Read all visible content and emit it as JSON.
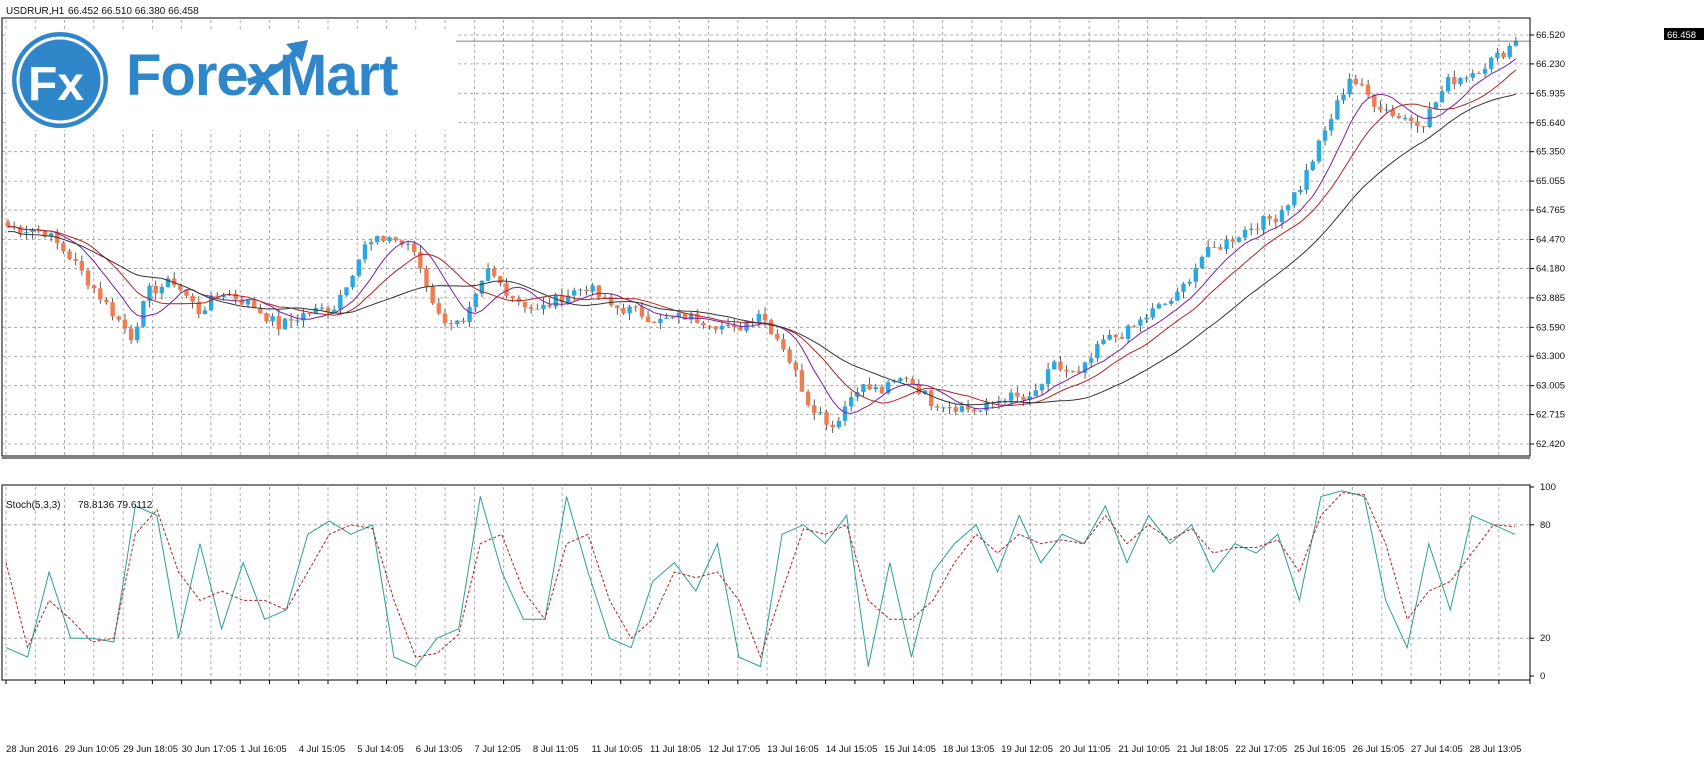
{
  "header": {
    "symbol": "USDRUR,H1",
    "ohlc": "66.452 66.510 66.380 66.458"
  },
  "logo": {
    "brand": "ForexMart",
    "mark": "Fx"
  },
  "current_price": "66.458",
  "chart_data": [
    {
      "type": "candlestick",
      "symbol": "USDRUR,H1",
      "y_ticks": [
        62.42,
        62.715,
        63.005,
        63.3,
        63.59,
        63.885,
        64.18,
        64.47,
        64.765,
        65.055,
        65.35,
        65.64,
        65.935,
        66.23,
        66.52
      ],
      "y_tick_labels": [
        "62.420",
        "62.715",
        "63.005",
        "63.300",
        "63.590",
        "63.885",
        "64.180",
        "64.470",
        "64.765",
        "65.055",
        "65.350",
        "65.640",
        "65.935",
        "66.230",
        "66.520"
      ],
      "ylim": [
        62.3,
        66.67
      ],
      "x_tick_labels": [
        "28 Jun 2016",
        "29 Jun 10:05",
        "29 Jun 18:05",
        "30 Jun 17:05",
        "1 Jul 16:05",
        "4 Jul 15:05",
        "5 Jul 14:05",
        "6 Jul 13:05",
        "7 Jul 12:05",
        "8 Jul 11:05",
        "11 Jul 10:05",
        "11 Jul 18:05",
        "12 Jul 17:05",
        "13 Jul 16:05",
        "14 Jul 15:05",
        "15 Jul 14:05",
        "18 Jul 13:05",
        "19 Jul 12:05",
        "20 Jul 11:05",
        "21 Jul 10:05",
        "21 Jul 18:05",
        "22 Jul 17:05",
        "25 Jul 16:05",
        "26 Jul 15:05",
        "27 Jul 14:05",
        "28 Jul 13:05"
      ],
      "close_path": [
        [
          0,
          64.6
        ],
        [
          6,
          64.55
        ],
        [
          10,
          64.3
        ],
        [
          15,
          63.9
        ],
        [
          20,
          63.5
        ],
        [
          23,
          63.95
        ],
        [
          27,
          64.05
        ],
        [
          31,
          63.75
        ],
        [
          35,
          63.95
        ],
        [
          40,
          63.8
        ],
        [
          44,
          63.6
        ],
        [
          48,
          63.72
        ],
        [
          53,
          63.8
        ],
        [
          58,
          64.4
        ],
        [
          62,
          64.5
        ],
        [
          66,
          64.35
        ],
        [
          70,
          63.7
        ],
        [
          74,
          63.6
        ],
        [
          78,
          64.15
        ],
        [
          82,
          63.9
        ],
        [
          86,
          63.75
        ],
        [
          90,
          63.9
        ],
        [
          94,
          64.0
        ],
        [
          98,
          63.8
        ],
        [
          102,
          63.75
        ],
        [
          106,
          63.65
        ],
        [
          110,
          63.7
        ],
        [
          114,
          63.65
        ],
        [
          118,
          63.55
        ],
        [
          122,
          63.75
        ],
        [
          126,
          63.4
        ],
        [
          130,
          62.85
        ],
        [
          134,
          62.6
        ],
        [
          138,
          63.0
        ],
        [
          142,
          62.95
        ],
        [
          146,
          63.1
        ],
        [
          150,
          62.85
        ],
        [
          154,
          62.8
        ],
        [
          158,
          62.75
        ],
        [
          162,
          62.9
        ],
        [
          166,
          62.85
        ],
        [
          170,
          63.2
        ],
        [
          174,
          63.1
        ],
        [
          178,
          63.45
        ],
        [
          182,
          63.55
        ],
        [
          186,
          63.75
        ],
        [
          190,
          63.9
        ],
        [
          194,
          64.3
        ],
        [
          198,
          64.45
        ],
        [
          202,
          64.6
        ],
        [
          206,
          64.7
        ],
        [
          210,
          65.0
        ],
        [
          214,
          65.55
        ],
        [
          218,
          66.1
        ],
        [
          222,
          65.85
        ],
        [
          226,
          65.7
        ],
        [
          230,
          65.65
        ],
        [
          234,
          66.05
        ],
        [
          238,
          66.15
        ],
        [
          242,
          66.3
        ],
        [
          245,
          66.46
        ]
      ],
      "current_price": 66.458
    },
    {
      "type": "line",
      "indicator": "Stoch(5,3,3)",
      "values_text": "78.8136 79.6112",
      "y_ticks": [
        0,
        20,
        80,
        100
      ],
      "ylim": [
        0,
        100
      ],
      "series": [
        {
          "name": "Main",
          "color": "#2a9d9d",
          "values": [
            15,
            10,
            55,
            20,
            20,
            18,
            90,
            85,
            20,
            70,
            25,
            60,
            30,
            35,
            75,
            82,
            75,
            80,
            10,
            5,
            20,
            25,
            95,
            55,
            30,
            30,
            95,
            55,
            20,
            15,
            50,
            60,
            45,
            70,
            10,
            5,
            75,
            80,
            70,
            85,
            5,
            60,
            10,
            55,
            70,
            80,
            55,
            85,
            60,
            75,
            70,
            90,
            60,
            85,
            70,
            80,
            55,
            70,
            65,
            75,
            40,
            95,
            98,
            95,
            40,
            15,
            70,
            35,
            85,
            80,
            75
          ]
        },
        {
          "name": "Signal",
          "color": "#b22222",
          "values": [
            60,
            15,
            40,
            30,
            18,
            20,
            75,
            88,
            55,
            40,
            45,
            40,
            40,
            35,
            55,
            75,
            80,
            78,
            40,
            10,
            12,
            22,
            70,
            75,
            45,
            30,
            70,
            75,
            40,
            20,
            30,
            55,
            52,
            55,
            40,
            10,
            45,
            78,
            75,
            80,
            40,
            30,
            30,
            40,
            60,
            75,
            65,
            75,
            70,
            72,
            70,
            85,
            70,
            80,
            72,
            78,
            65,
            68,
            68,
            72,
            55,
            85,
            97,
            96,
            70,
            30,
            45,
            50,
            65,
            80,
            79
          ]
        }
      ]
    }
  ]
}
